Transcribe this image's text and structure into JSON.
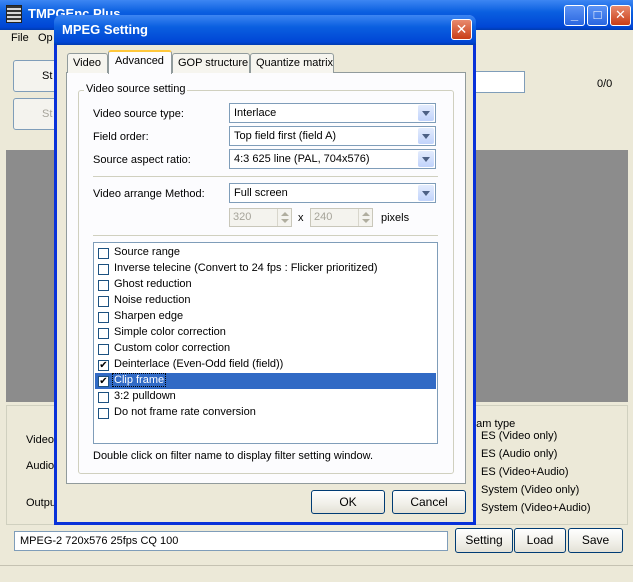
{
  "main_window": {
    "title": "TMPGEnc Plus",
    "menu": {
      "file": "File",
      "options": "Op"
    },
    "btn_start": "St",
    "btn_step": "St",
    "counter": "0/0",
    "labels": {
      "video": "Video",
      "audio": "Audio",
      "output": "Outpu"
    },
    "stream_type": {
      "title": "eam type",
      "options": [
        "ES (Video only)",
        "ES (Audio only)",
        "ES (Video+Audio)",
        "System (Video only)",
        "System (Video+Audio)"
      ]
    },
    "status_text": "MPEG-2 720x576 25fps CQ 100",
    "buttons": {
      "setting": "Setting",
      "load": "Load",
      "save": "Save"
    }
  },
  "dialog": {
    "title": "MPEG Setting",
    "tabs": [
      "Video",
      "Advanced",
      "GOP structure",
      "Quantize matrix"
    ],
    "active_tab": "Advanced",
    "group_title": "Video source setting",
    "fields": {
      "source_type": {
        "label": "Video source type:",
        "value": "Interlace"
      },
      "field_order": {
        "label": "Field order:",
        "value": "Top field first (field A)"
      },
      "aspect_ratio": {
        "label": "Source aspect ratio:",
        "value": "4:3 625 line (PAL, 704x576)"
      },
      "arrange_method": {
        "label": "Video arrange Method:",
        "value": "Full screen"
      }
    },
    "size": {
      "width": "320",
      "height": "240",
      "x": "x",
      "unit": "pixels"
    },
    "filters": [
      {
        "label": "Source range",
        "checked": false
      },
      {
        "label": "Inverse telecine (Convert to 24 fps : Flicker prioritized)",
        "checked": false
      },
      {
        "label": "Ghost reduction",
        "checked": false
      },
      {
        "label": "Noise reduction",
        "checked": false
      },
      {
        "label": "Sharpen edge",
        "checked": false
      },
      {
        "label": "Simple color correction",
        "checked": false
      },
      {
        "label": "Custom color correction",
        "checked": false
      },
      {
        "label": "Deinterlace (Even-Odd field (field))",
        "checked": true
      },
      {
        "label": "Clip frame",
        "checked": true,
        "selected": true
      },
      {
        "label": "3:2 pulldown",
        "checked": false
      },
      {
        "label": "Do not frame rate conversion",
        "checked": false
      }
    ],
    "hint": "Double click on filter name to display filter setting window.",
    "ok": "OK",
    "cancel": "Cancel"
  },
  "colors": {
    "titlebar": "#0a5fe0",
    "selection": "#316ac5",
    "tab_highlight": "#ffc83c"
  }
}
